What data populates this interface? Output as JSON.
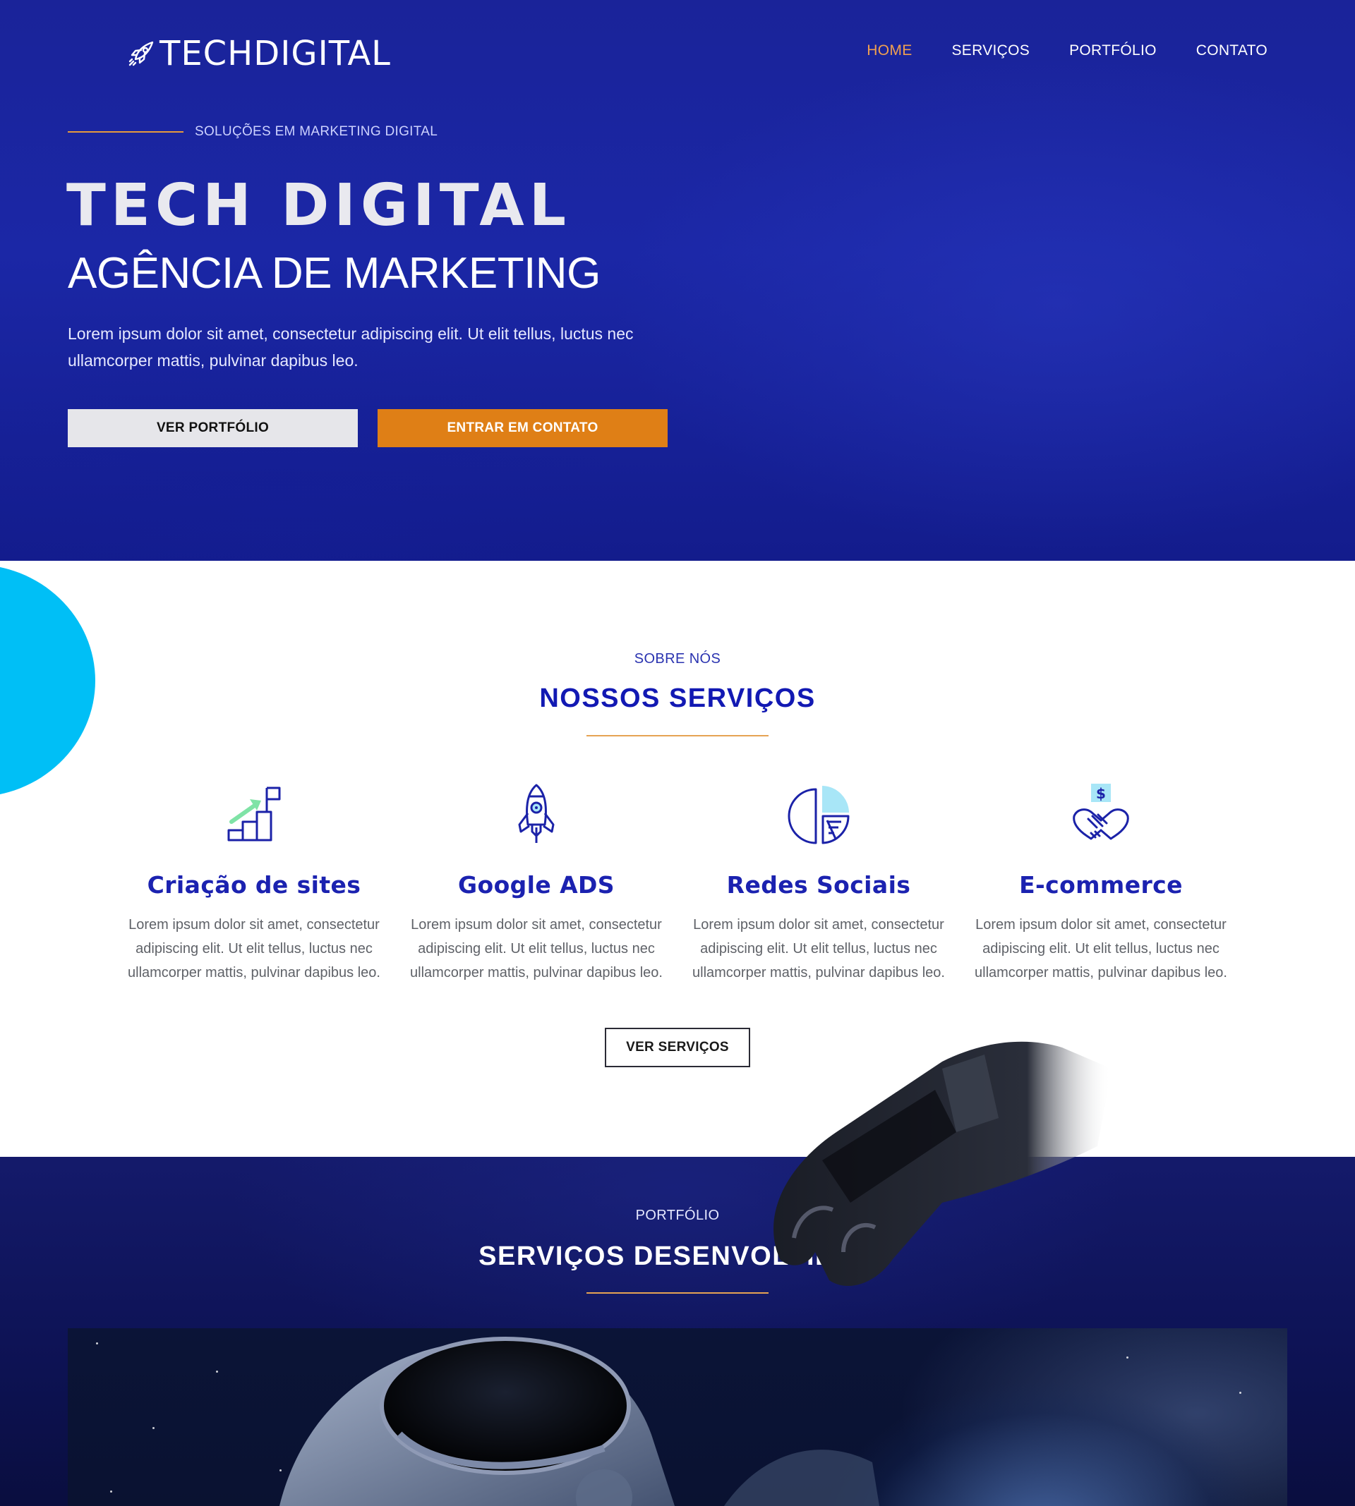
{
  "brand": {
    "name": "TECHDIGITAL"
  },
  "nav": {
    "items": [
      "HOME",
      "SERVIÇOS",
      "PORTFÓLIO",
      "CONTATO"
    ],
    "active": "HOME"
  },
  "hero": {
    "eyebrow": "SOLUÇÕES EM MARKETING DIGITAL",
    "title": "TECH DIGITAL",
    "subtitle": "AGÊNCIA DE MARKETING",
    "text": "Lorem ipsum dolor sit amet, consectetur adipiscing elit. Ut elit tellus, luctus nec ullamcorper mattis, pulvinar dapibus leo.",
    "buttons": {
      "portfolio": "VER PORTFÓLIO",
      "contact": "ENTRAR EM CONTATO"
    }
  },
  "services": {
    "eyebrow": "SOBRE NÓS",
    "title": "NOSSOS SERVIÇOS",
    "items": [
      {
        "icon": "growth-stairs-icon",
        "title": "Criação de sites",
        "text": "Lorem ipsum dolor sit amet, consectetur adipiscing elit. Ut elit tellus, luctus nec ullamcorper mattis, pulvinar dapibus leo."
      },
      {
        "icon": "rocket-icon",
        "title": "Google ADS",
        "text": "Lorem ipsum dolor sit amet, consectetur adipiscing elit. Ut elit tellus, luctus nec ullamcorper mattis, pulvinar dapibus leo."
      },
      {
        "icon": "pie-chart-icon",
        "title": "Redes Sociais",
        "text": "Lorem ipsum dolor sit amet, consectetur adipiscing elit. Ut elit tellus, luctus nec ullamcorper mattis, pulvinar dapibus leo."
      },
      {
        "icon": "handshake-dollar-icon",
        "title": "E-commerce",
        "text": "Lorem ipsum dolor sit amet, consectetur adipiscing elit. Ut elit tellus, luctus nec ullamcorper mattis, pulvinar dapibus leo."
      }
    ],
    "button": "VER SERVIÇOS"
  },
  "portfolio": {
    "eyebrow": "PORTFÓLIO",
    "title": "SERVIÇOS DESENVOLVIDOS"
  },
  "colors": {
    "hero_bg": "#1b27a6",
    "accent_orange": "#df7f16",
    "heading_blue": "#1b22b0",
    "blob_cyan": "#00bff6",
    "icon_green": "#7fe3a6",
    "icon_light_blue": "#a8e6f7"
  }
}
